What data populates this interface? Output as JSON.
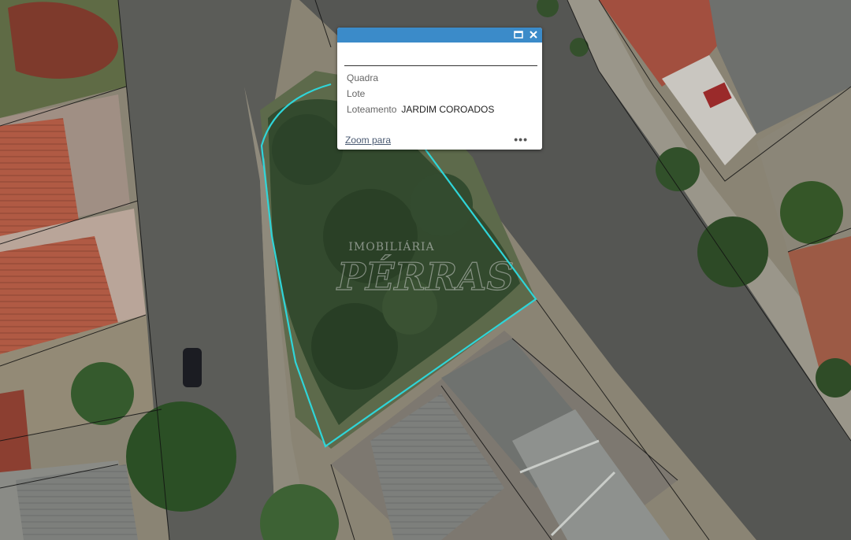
{
  "map": {
    "watermark_line1": "IMOBILIÁRIA",
    "watermark_line2": "PÉRRAS",
    "parcel_outline_color": "#2fd5d8"
  },
  "popup": {
    "header_color": "#3b8bc9",
    "title": "",
    "maximize_icon": "maximize-icon",
    "close_icon": "close-icon",
    "attributes": [
      {
        "label": "Quadra",
        "value": ""
      },
      {
        "label": "Lote",
        "value": ""
      },
      {
        "label": "Loteamento",
        "value": "JARDIM COROADOS"
      }
    ],
    "zoom_label": "Zoom para",
    "more_label": "•••"
  }
}
